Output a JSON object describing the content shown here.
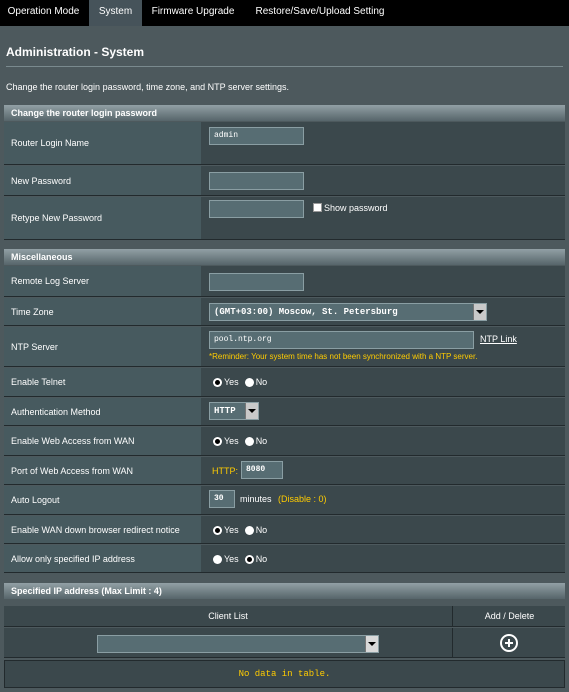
{
  "tabs": [
    {
      "label": "Operation Mode"
    },
    {
      "label": "System"
    },
    {
      "label": "Firmware Upgrade"
    },
    {
      "label": "Restore/Save/Upload Setting"
    }
  ],
  "page": {
    "title": "Administration - System",
    "description": "Change the router login password, time zone, and NTP server settings."
  },
  "login_section": {
    "header": "Change the router login password",
    "login_name_label": "Router Login Name",
    "login_name_value": "admin",
    "new_password_label": "New Password",
    "new_password_value": "",
    "retype_password_label": "Retype New Password",
    "retype_password_value": "",
    "show_password_label": "Show password",
    "show_password_checked": false
  },
  "misc_section": {
    "header": "Miscellaneous",
    "remote_log_label": "Remote Log Server",
    "remote_log_value": "",
    "time_zone_label": "Time Zone",
    "time_zone_value": "(GMT+03:00) Moscow, St. Petersburg",
    "ntp_label": "NTP Server",
    "ntp_value": "pool.ntp.org",
    "ntp_link": "NTP Link",
    "ntp_reminder": "*Reminder: Your system time has not been synchronized with a NTP server.",
    "telnet_label": "Enable Telnet",
    "telnet_value": "Yes",
    "auth_label": "Authentication Method",
    "auth_value": "HTTP",
    "web_wan_label": "Enable Web Access from WAN",
    "web_wan_value": "Yes",
    "port_label": "Port of Web Access from WAN",
    "port_prefix": "HTTP:",
    "port_value": "8080",
    "logout_label": "Auto Logout",
    "logout_value": "30",
    "logout_unit": "minutes",
    "logout_hint": "(Disable : 0)",
    "redirect_label": "Enable WAN down browser redirect notice",
    "redirect_value": "Yes",
    "allow_ip_label": "Allow only specified IP address",
    "allow_ip_value": "No",
    "yes_label": "Yes",
    "no_label": "No"
  },
  "ip_section": {
    "header": "Specified IP address (Max Limit : 4)",
    "col_client": "Client List",
    "col_action": "Add / Delete",
    "client_value": "",
    "empty_text": "No data in table."
  },
  "colors": {
    "background": "#4d595d",
    "accent_yellow": "#ffcc00"
  }
}
